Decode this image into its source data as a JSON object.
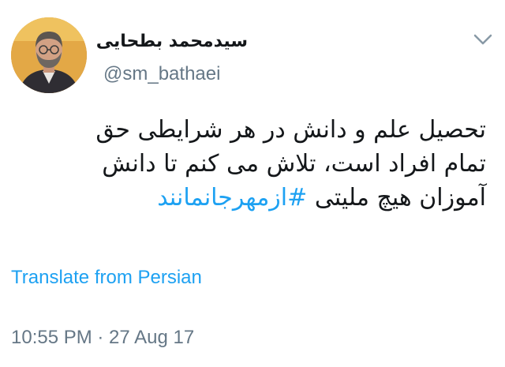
{
  "tweet": {
    "author": {
      "display_name": "سیدمحمد بطحایی",
      "handle": "@sm_bathaei",
      "avatar_icon": "profile-photo"
    },
    "menu_icon": "chevron-down-icon",
    "text_lines": [
      "تحصیل علم و دانش در هر شرایطی حق",
      "تمام افراد است، تلاش می کنم تا دانش",
      "آموزان هیچ ملیتی"
    ],
    "hashtag": "#ازمهرجانمانند",
    "translate_label": "Translate from Persian",
    "timestamp": "10:55 PM · 27 Aug 17"
  },
  "colors": {
    "link": "#1da1f2",
    "secondary_text": "#657786",
    "primary_text": "#14171a",
    "background": "#ffffff"
  }
}
